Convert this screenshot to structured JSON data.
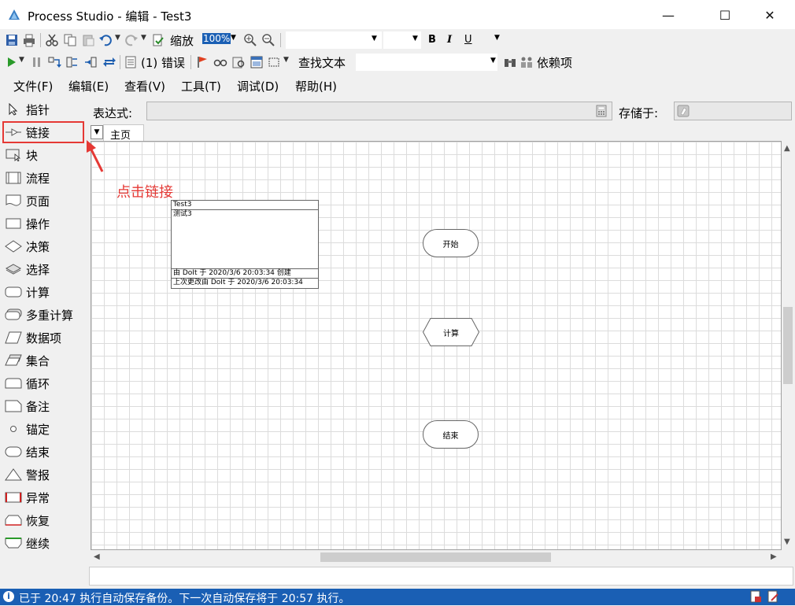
{
  "window": {
    "title": "Process Studio  - 编辑 - Test3",
    "minimize": "—",
    "maximize": "☐",
    "close": "✕"
  },
  "toolbar1": {
    "zoom_label": "缩放",
    "zoom_value": "100%",
    "bold": "B",
    "italic": "I",
    "underline": "U"
  },
  "toolbar2": {
    "errors_label": "(1) 错误",
    "find_text_label": "查找文本",
    "dependencies_label": "依赖项"
  },
  "menu": {
    "items": [
      "文件(F)",
      "编辑(E)",
      "查看(V)",
      "工具(T)",
      "调试(D)",
      "帮助(H)"
    ]
  },
  "toolbox": {
    "items": [
      {
        "label": "指针",
        "icon": "pointer-icon"
      },
      {
        "label": "链接",
        "icon": "link-icon"
      },
      {
        "label": "块",
        "icon": "block-icon"
      },
      {
        "label": "流程",
        "icon": "process-icon"
      },
      {
        "label": "页面",
        "icon": "page-icon"
      },
      {
        "label": "操作",
        "icon": "action-icon"
      },
      {
        "label": "决策",
        "icon": "decision-icon"
      },
      {
        "label": "选择",
        "icon": "choice-icon"
      },
      {
        "label": "计算",
        "icon": "calculation-icon"
      },
      {
        "label": "多重计算",
        "icon": "multi-calculation-icon"
      },
      {
        "label": "数据项",
        "icon": "data-item-icon"
      },
      {
        "label": "集合",
        "icon": "collection-icon"
      },
      {
        "label": "循环",
        "icon": "loop-icon"
      },
      {
        "label": "备注",
        "icon": "note-icon"
      },
      {
        "label": "锚定",
        "icon": "anchor-icon"
      },
      {
        "label": "结束",
        "icon": "end-icon"
      },
      {
        "label": "警报",
        "icon": "alert-icon"
      },
      {
        "label": "异常",
        "icon": "exception-icon"
      },
      {
        "label": "恢复",
        "icon": "recover-icon"
      },
      {
        "label": "继续",
        "icon": "resume-icon"
      }
    ]
  },
  "annotation": {
    "text": "点击链接"
  },
  "expression": {
    "label": "表达式:",
    "store_label": "存储于:"
  },
  "page_tabs": {
    "active": "主页"
  },
  "canvas": {
    "info_box": {
      "name": "Test3",
      "description": "测试3",
      "created": "由 DoIt 于 2020/3/6  20:03:34 创建",
      "modified": "上次更改由 DoIt 于 2020/3/6 20:03:34"
    },
    "stages": {
      "start": "开始",
      "calc": "计算",
      "end": "结束"
    }
  },
  "status": {
    "message": "已于 20:47 执行自动保存备份。下一次自动保存将于 20:57 执行。"
  }
}
